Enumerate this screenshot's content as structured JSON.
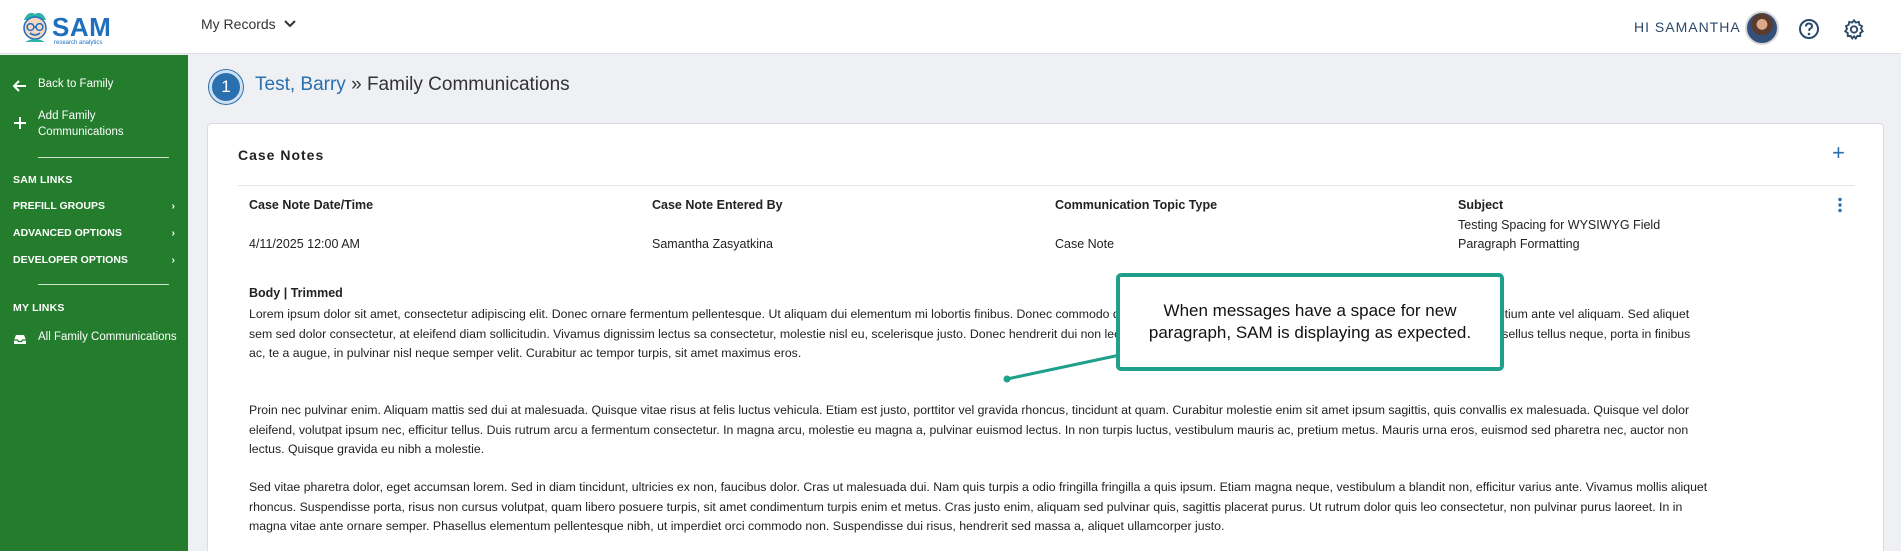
{
  "header": {
    "logo_text": "SAM",
    "logo_sub": "research analytics",
    "records_menu": "My Records",
    "greeting": "HI SAMANTHA"
  },
  "sidebar": {
    "back": "Back to Family",
    "add": "Add Family Communications",
    "sam_links": "SAM LINKS",
    "prefill": "PREFILL GROUPS",
    "advanced": "ADVANCED OPTIONS",
    "developer": "DEVELOPER OPTIONS",
    "my_links": "MY LINKS",
    "all_comms": "All Family Communications"
  },
  "breadcrumb": {
    "badge": "1",
    "person": "Test, Barry",
    "separator": " » ",
    "page": "Family Communications"
  },
  "card": {
    "title": "Case Notes",
    "columns": {
      "date_head": "Case Note Date/Time",
      "date_val": "4/11/2025 12:00 AM",
      "by_head": "Case Note Entered By",
      "by_val": "Samantha Zasyatkina",
      "topic_head": "Communication Topic Type",
      "topic_val": "Case Note",
      "subject_head": "Subject",
      "subject_val_1": "Testing Spacing for WYSIWYG Field",
      "subject_val_2": "Paragraph Formatting"
    },
    "body_label": "Body | Trimmed",
    "paragraphs": [
      "Lorem ipsum dolor sit amet, consectetur adipiscing elit. Donec ornare fermentum pellentesque. Ut aliquam dui elementum mi lobortis finibus. Donec commodo                                                                                    d dolor dignissim accumsan. Suspendisse potenti. Aenean maximus pretium ante vel aliquam. Sed aliquet sem sed dolor consectetur, at eleifend diam sollicitudin. Vivamus dignissim lectus                                                                                    sa consectetur, molestie nisl eu, scelerisque justo. Donec hendrerit dui non lectus sollicitudin varius. Vestibulum ultricies turpis at lacinia facilisis. Phasellus tellus neque, porta in finibus ac, te                                                                                    a augue, in pulvinar nisl neque semper velit. Curabitur ac tempor turpis, sit amet maximus eros.",
      "Proin nec pulvinar enim. Aliquam mattis sed dui at malesuada. Quisque vitae risus at felis luctus vehicula. Etiam est justo, porttitor vel gravida rhoncus, tincidunt at quam. Curabitur molestie enim sit amet ipsum sagittis, quis convallis ex malesuada. Quisque vel dolor eleifend, volutpat ipsum nec, efficitur tellus. Duis rutrum arcu a fermentum consectetur. In magna arcu, molestie eu magna a, pulvinar euismod lectus. In non turpis luctus, vestibulum mauris ac, pretium metus. Mauris urna eros, euismod sed pharetra nec, auctor non lectus. Quisque gravida eu nibh a molestie.",
      "Sed vitae pharetra dolor, eget accumsan lorem. Sed in diam tincidunt, ultricies ex non, faucibus dolor. Cras ut malesuada dui. Nam quis turpis a odio fringilla fringilla a quis ipsum. Etiam magna neque, vestibulum a blandit non, efficitur varius ante. Vivamus mollis aliquet rhoncus. Suspendisse porta, risus non cursus volutpat, quam libero posuere turpis, sit amet condimentum turpis enim et metus. Cras justo enim, aliquam sed pulvinar quis, sagittis placerat purus. Ut rutrum dolor quis leo consectetur, non pulvinar purus laoreet. In in magna vitae ante ornare semper. Phasellus elementum pellentesque nibh, ut imperdiet orci commodo non. Suspendisse dui risus, hendrerit sed massa a, aliquet ullamcorper justo."
    ]
  },
  "callout": {
    "text": "When messages have a space for new paragraph, SAM is displaying as expected."
  },
  "colors": {
    "sidebar": "#237d2c",
    "brand_blue": "#2a6fae",
    "callout_border": "#1fa08a"
  },
  "icons": [
    "mascot-logo-icon",
    "chevron-down-icon",
    "help-icon",
    "gear-icon",
    "arrow-left-icon",
    "plus-icon",
    "chevron-right-icon",
    "inbox-icon",
    "kebab-menu-icon"
  ]
}
